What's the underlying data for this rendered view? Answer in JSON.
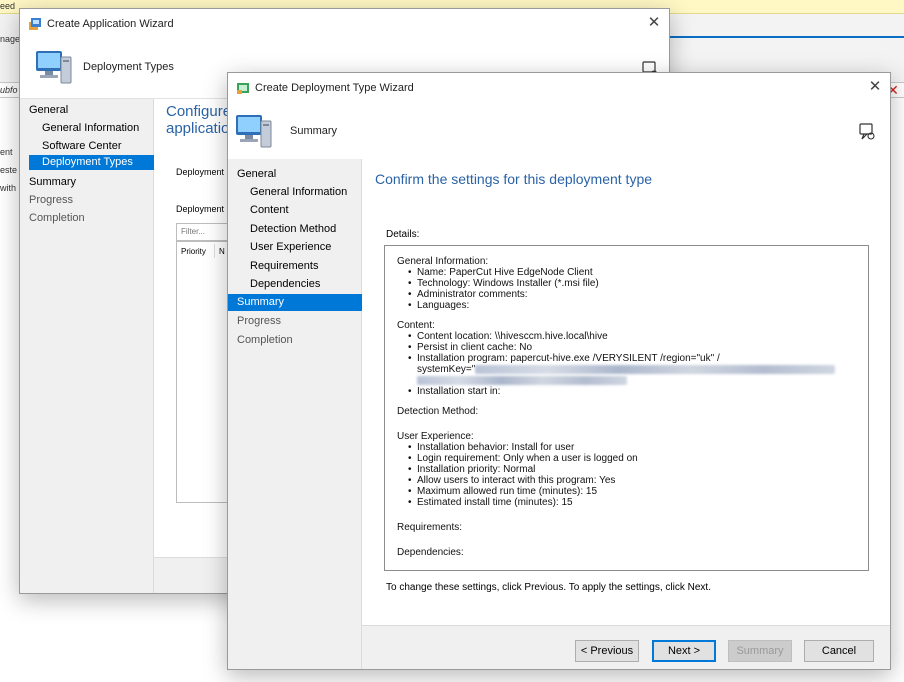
{
  "background_console": {
    "infobar_text_left": "eed",
    "infobar_text_mid": "...",
    "toolbar_text": "nage",
    "addr_text": "ubfo",
    "list_fragments": [
      "ent",
      "este",
      "with"
    ]
  },
  "app_wizard": {
    "title": "Create Application Wizard",
    "header_title": "Deployment Types",
    "nav": [
      {
        "label": "General",
        "level": 0,
        "selected": false
      },
      {
        "label": "General Information",
        "level": 1,
        "selected": false
      },
      {
        "label": "Software Center",
        "level": 1,
        "selected": false
      },
      {
        "label": "Deployment Types",
        "level": 1,
        "selected": true
      },
      {
        "label": "Summary",
        "level": 0,
        "selected": false
      },
      {
        "label": "Progress",
        "level": 0,
        "selected": false
      },
      {
        "label": "Completion",
        "level": 0,
        "selected": false
      }
    ],
    "heading_line1": "Configure",
    "heading_line2": "applicatior",
    "label1": "Deployment",
    "label2": "Deployment",
    "filter_placeholder": "Filter...",
    "col_priority": "Priority",
    "col_n": "N"
  },
  "dt_wizard": {
    "title": "Create Deployment Type Wizard",
    "header_title": "Summary",
    "nav": [
      {
        "label": "General",
        "level": 0,
        "selected": false
      },
      {
        "label": "General Information",
        "level": 1,
        "selected": false
      },
      {
        "label": "Content",
        "level": 1,
        "selected": false
      },
      {
        "label": "Detection Method",
        "level": 1,
        "selected": false
      },
      {
        "label": "User Experience",
        "level": 1,
        "selected": false
      },
      {
        "label": "Requirements",
        "level": 1,
        "selected": false
      },
      {
        "label": "Dependencies",
        "level": 1,
        "selected": false
      },
      {
        "label": "Summary",
        "level": 0,
        "selected": true
      },
      {
        "label": "Progress",
        "level": 0,
        "selected": false
      },
      {
        "label": "Completion",
        "level": 0,
        "selected": false
      }
    ],
    "page_heading": "Confirm the settings for this deployment type",
    "details_label": "Details:",
    "details": {
      "general_title": "General Information:",
      "general_items": [
        "Name: PaperCut Hive EdgeNode Client",
        "Technology: Windows Installer (*.msi file)",
        "Administrator comments:",
        "Languages:"
      ],
      "content_title": "Content:",
      "content_items": [
        "Content location: \\\\hivesccm.hive.local\\hive",
        "Persist in client cache: No",
        "Installation program: papercut-hive.exe /VERYSILENT /region=\"uk\" /",
        "systemKey=\""
      ],
      "install_start": "Installation start in:",
      "detection_title": "Detection Method:",
      "ux_title": "User Experience:",
      "ux_items": [
        "Installation behavior: Install for user",
        "Login requirement: Only when a user is logged on",
        "Installation priority: Normal",
        "Allow users to interact with this program: Yes",
        "Maximum allowed run time (minutes): 15",
        "Estimated install time (minutes): 15"
      ],
      "requirements_title": "Requirements:",
      "dependencies_title": "Dependencies:"
    },
    "instruction": "To change these settings, click Previous. To apply the settings, click Next.",
    "buttons": {
      "previous": "< Previous",
      "next": "Next >",
      "summary": "Summary",
      "cancel": "Cancel"
    }
  },
  "colors": {
    "accent": "#0078d7",
    "heading": "#2a63a6",
    "nav_bg": "#f0f0f0"
  }
}
